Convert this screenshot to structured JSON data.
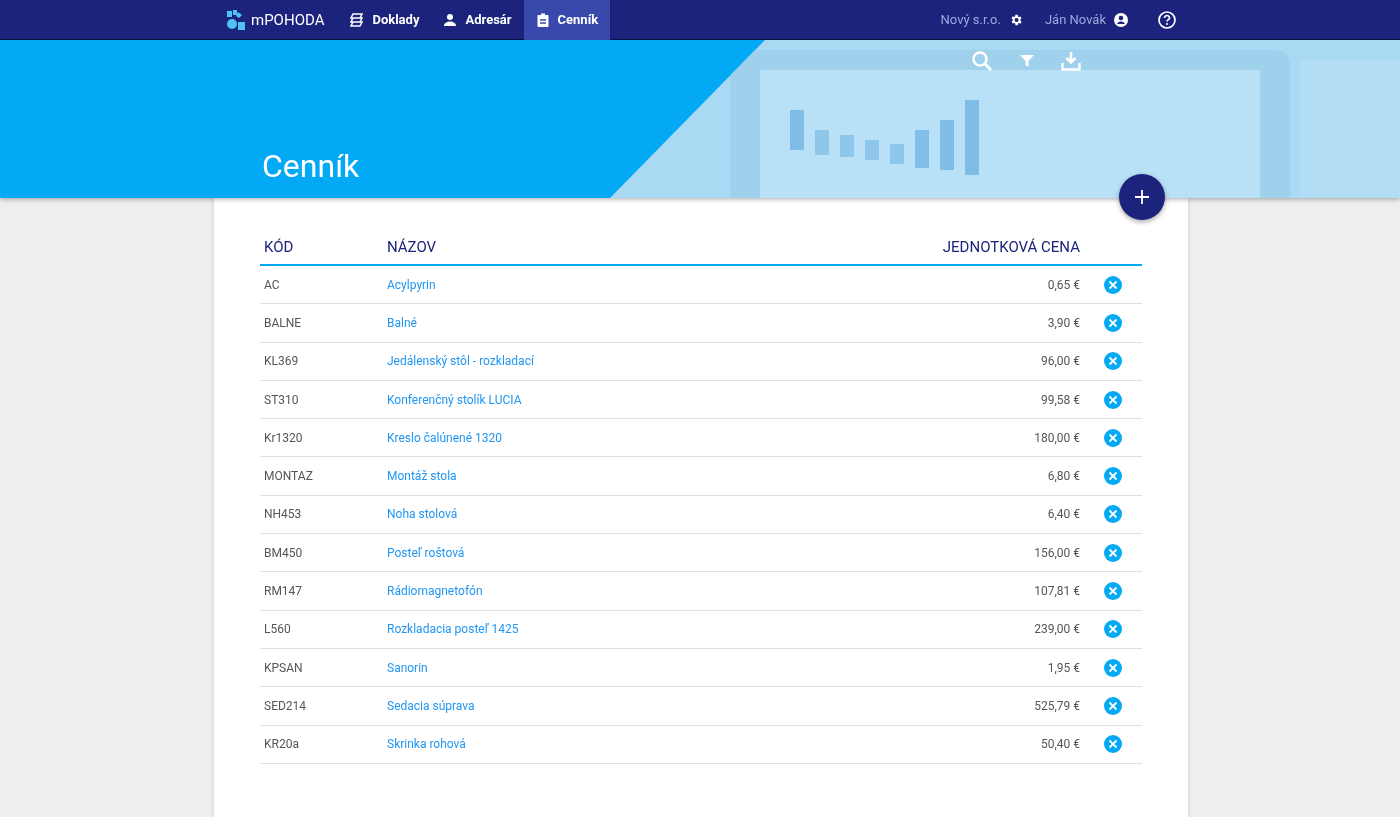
{
  "app": {
    "name": "mPOHODA"
  },
  "nav": [
    {
      "label": "Doklady",
      "kind": "documents",
      "selected": false
    },
    {
      "label": "Adresár",
      "kind": "person",
      "selected": false
    },
    {
      "label": "Cenník",
      "kind": "clipboard",
      "selected": true
    }
  ],
  "company": "Nový s.r.o.",
  "user": "Ján Novák",
  "page_title": "Cenník",
  "table": {
    "columns": [
      "KÓD",
      "NÁZOV",
      "JEDNOTKOVÁ CENA"
    ],
    "rows": [
      {
        "code": "AC",
        "name": "Acylpyrin",
        "price": "0,65 €"
      },
      {
        "code": "BALNE",
        "name": "Balné",
        "price": "3,90 €"
      },
      {
        "code": "KL369",
        "name": "Jedálenský stôl - rozkladací",
        "price": "96,00 €"
      },
      {
        "code": "ST310",
        "name": "Konferenčný stolík LUCIA",
        "price": "99,58 €"
      },
      {
        "code": "Kr1320",
        "name": "Kreslo čalúnené 1320",
        "price": "180,00 €"
      },
      {
        "code": "MONTAZ",
        "name": "Montáž stola",
        "price": "6,80 €"
      },
      {
        "code": "NH453",
        "name": "Noha stolová",
        "price": "6,40 €"
      },
      {
        "code": "BM450",
        "name": "Posteľ roštová",
        "price": "156,00 €"
      },
      {
        "code": "RM147",
        "name": "Rádiomagnetofón",
        "price": "107,81 €"
      },
      {
        "code": "L560",
        "name": "Rozkladacia posteľ 1425",
        "price": "239,00 €"
      },
      {
        "code": "KPSAN",
        "name": "Sanorin",
        "price": "1,95 €"
      },
      {
        "code": "SED214",
        "name": "Sedacia súprava",
        "price": "525,79 €"
      },
      {
        "code": "KR20a",
        "name": "Skrinka rohová",
        "price": "50,40 €"
      }
    ]
  }
}
